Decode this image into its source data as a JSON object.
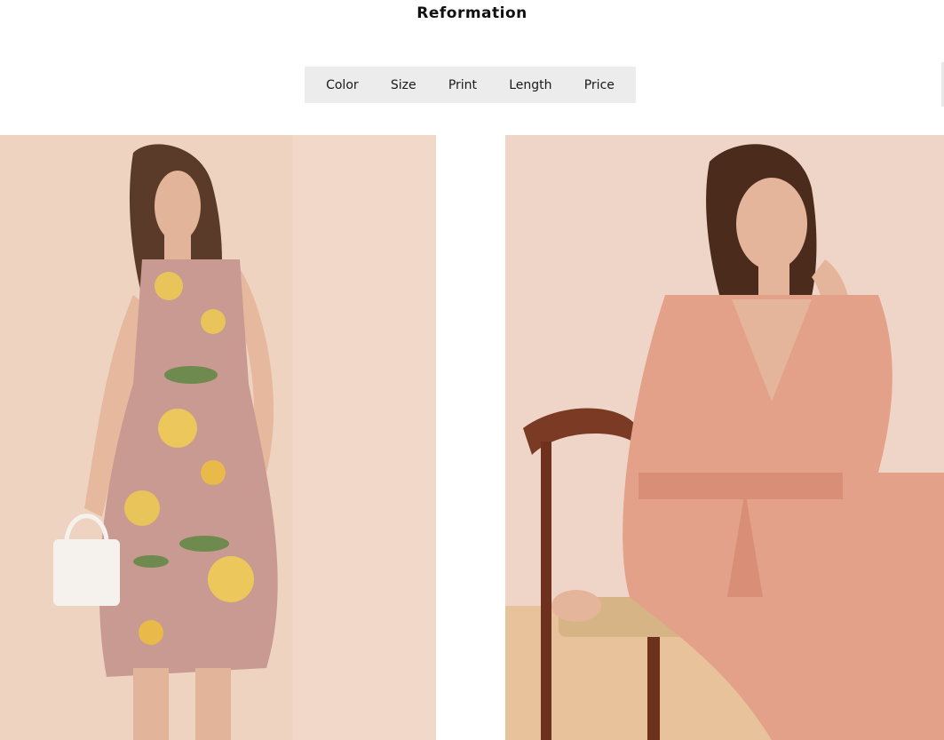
{
  "header": {
    "brand": "Reformation"
  },
  "filters": [
    {
      "label": "Color"
    },
    {
      "label": "Size"
    },
    {
      "label": "Print"
    },
    {
      "label": "Length"
    },
    {
      "label": "Price"
    }
  ],
  "colors": {
    "filter_bar_bg": "#ececec",
    "photo_bg_1": "#edd0bd",
    "photo_bg_2": "#eed3c6",
    "dress_floral_base": "#c99a92",
    "jumpsuit_pink": "#e3a189"
  }
}
